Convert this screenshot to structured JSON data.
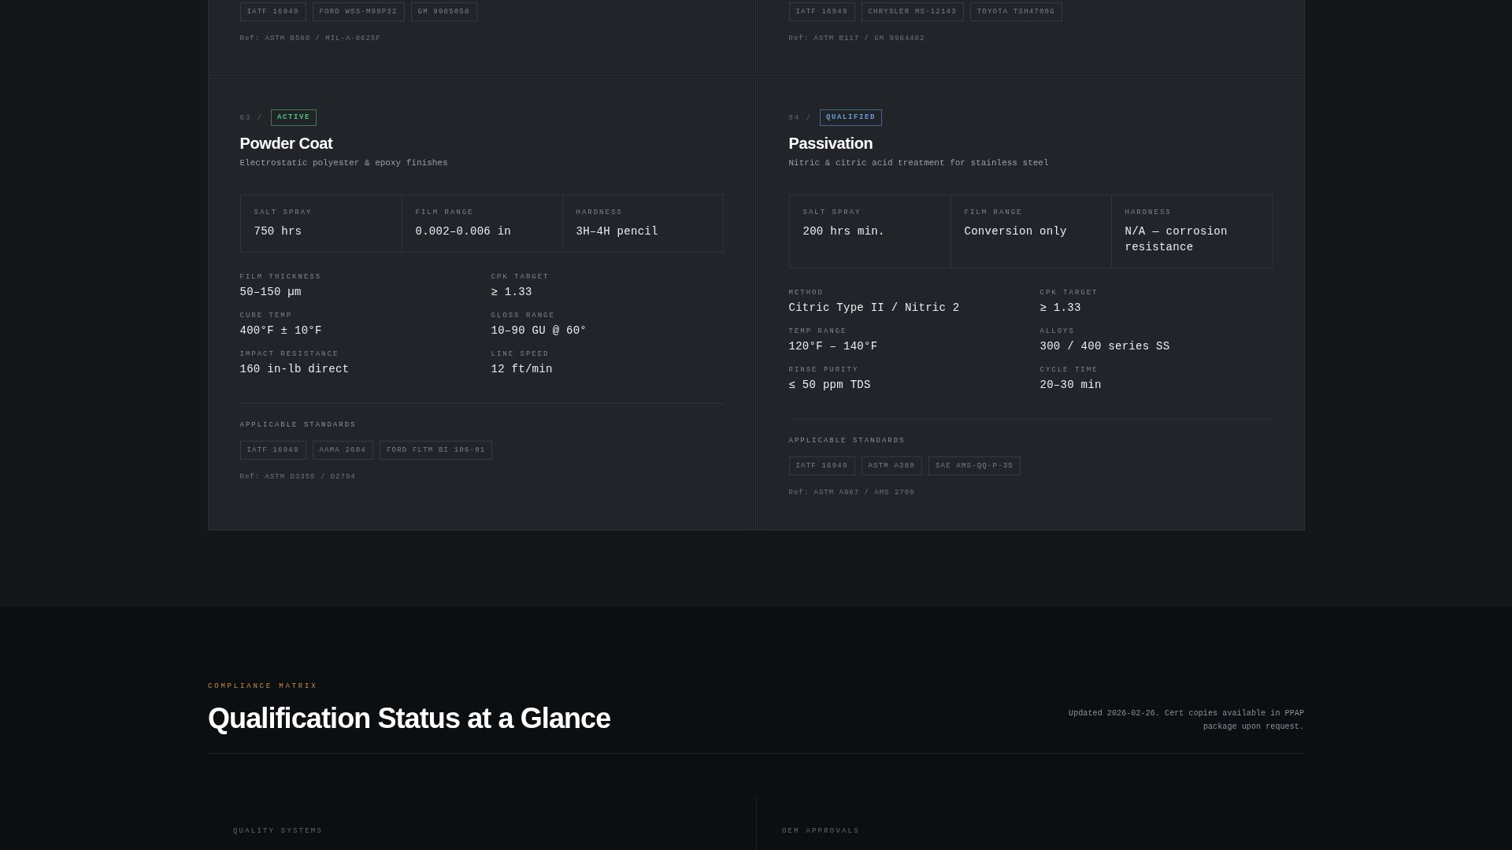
{
  "process_cards": [
    {
      "standards": [
        "IATF 16949",
        "FORD WSS-M99P32",
        "GM 9985058"
      ],
      "ref": "Ref: ASTM B580 / MIL-A-8625F"
    },
    {
      "standards": [
        "IATF 16949",
        "CHRYSLER MS-12143",
        "TOYOTA TSH4700G"
      ],
      "ref": "Ref: ASTM B117 / GM 9984482"
    },
    {
      "number": "03 /",
      "status": {
        "label": "ACTIVE",
        "color": "#4cc27a"
      },
      "title": "Powder Coat",
      "subtitle": "Electrostatic polyester & epoxy finishes",
      "key_stats": [
        {
          "label": "SALT SPRAY",
          "value": "750 hrs"
        },
        {
          "label": "FILM RANGE",
          "value": "0.002–0.006 in"
        },
        {
          "label": "HARDNESS",
          "value": "3H–4H pencil"
        }
      ],
      "specs": [
        {
          "label": "FILM THICKNESS",
          "value": "50–150 µm"
        },
        {
          "label": "CPK TARGET",
          "value": "≥ 1.33"
        },
        {
          "label": "CURE TEMP",
          "value": "400°F ± 10°F"
        },
        {
          "label": "GLOSS RANGE",
          "value": "10–90 GU @ 60°"
        },
        {
          "label": "IMPACT RESISTANCE",
          "value": "160 in-lb direct"
        },
        {
          "label": "LINE SPEED",
          "value": "12 ft/min"
        }
      ],
      "standards_heading": "APPLICABLE STANDARDS",
      "standards": [
        "IATF 16949",
        "AAMA 2604",
        "FORD FLTM BI 106-01"
      ],
      "ref": "Ref: ASTM D3359 / D2794"
    },
    {
      "number": "04 /",
      "status": {
        "label": "QUALIFIED",
        "color": "#6a9ee0"
      },
      "title": "Passivation",
      "subtitle": "Nitric & citric acid treatment for stainless steel",
      "key_stats": [
        {
          "label": "SALT SPRAY",
          "value": "200 hrs min."
        },
        {
          "label": "FILM RANGE",
          "value": "Conversion only"
        },
        {
          "label": "HARDNESS",
          "value": "N/A — corrosion resistance"
        }
      ],
      "specs": [
        {
          "label": "METHOD",
          "value": "Citric Type II / Nitric 2"
        },
        {
          "label": "CPK TARGET",
          "value": "≥ 1.33"
        },
        {
          "label": "TEMP RANGE",
          "value": "120°F – 140°F"
        },
        {
          "label": "ALLOYS",
          "value": "300 / 400 series SS"
        },
        {
          "label": "RINSE PURITY",
          "value": "≤ 50 ppm TDS"
        },
        {
          "label": "CYCLE TIME",
          "value": "20–30 min"
        }
      ],
      "standards_heading": "APPLICABLE STANDARDS",
      "standards": [
        "IATF 16949",
        "ASTM A380",
        "SAE AMS-QQ-P-35"
      ],
      "ref": "Ref: ASTM A967 / AMS 2700"
    }
  ],
  "compliance": {
    "eyebrow": "COMPLIANCE MATRIX",
    "title": "Qualification Status at a Glance",
    "note": "Updated 2026-02-26. Cert copies available in PPAP package upon request.",
    "columns": [
      {
        "heading": "QUALITY SYSTEMS"
      },
      {
        "heading": "OEM APPROVALS"
      }
    ]
  }
}
